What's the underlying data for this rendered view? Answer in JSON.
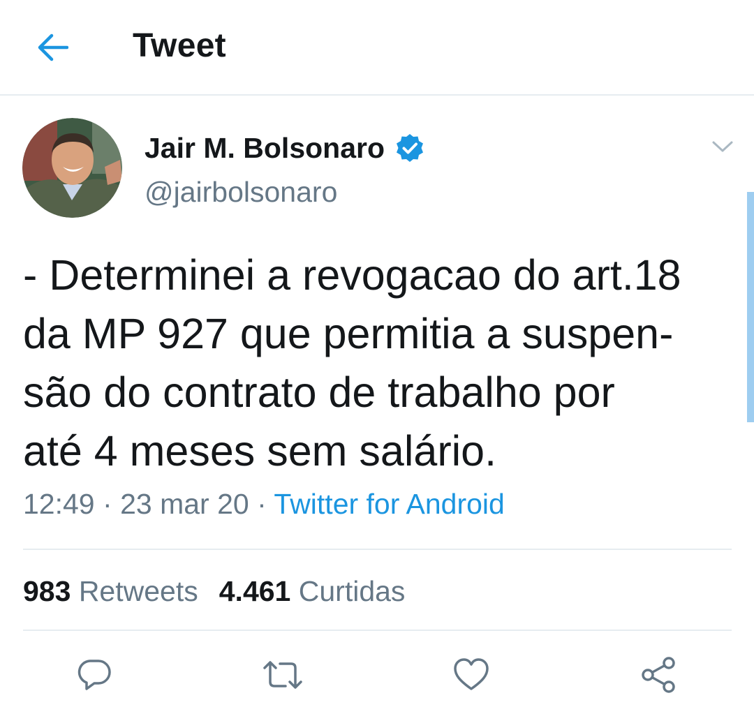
{
  "header": {
    "title": "Tweet",
    "back_icon": "arrow-left-icon"
  },
  "author": {
    "name": "Jair M. Bolsonaro",
    "handle": "@jairbolsonaro",
    "verified": true
  },
  "tweet": {
    "lines": [
      "- Determinei a revogacao do art.18",
      "da MP 927 que permitia a suspen-",
      "são do contrato de trabalho por",
      "até 4 meses sem salário."
    ],
    "time": "12:49",
    "separator": "·",
    "date": "23 mar 20",
    "source": "Twitter for Android"
  },
  "stats": {
    "retweets_count": "983",
    "retweets_label": "Retweets",
    "likes_count": "4.461",
    "likes_label": "Curtidas"
  },
  "actions": [
    "reply-icon",
    "retweet-icon",
    "like-icon",
    "share-icon"
  ],
  "colors": {
    "accent": "#1b95e0",
    "text": "#14171a",
    "secondary": "#657786",
    "divider": "#e6ecf0"
  }
}
